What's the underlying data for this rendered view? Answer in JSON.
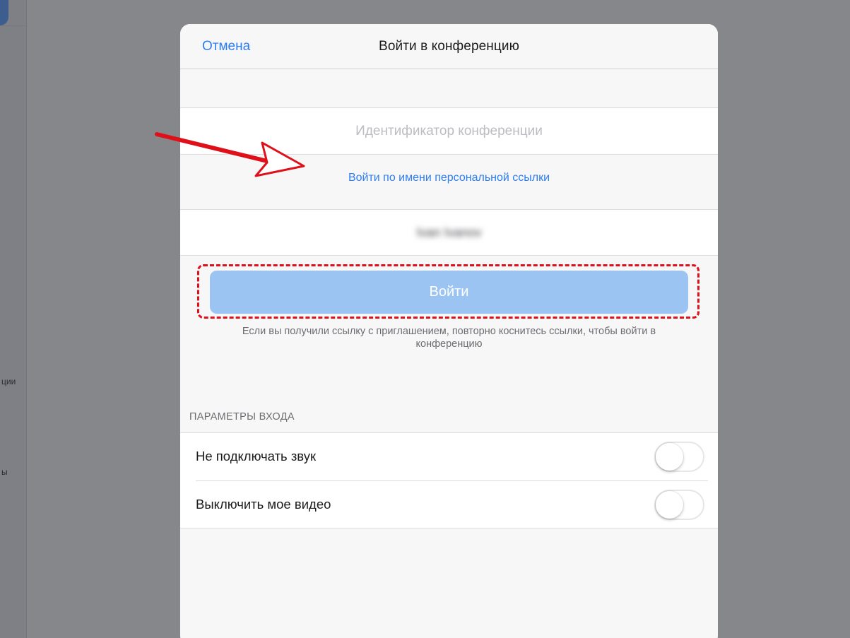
{
  "background": {
    "fragments": [
      "ции",
      "ы"
    ]
  },
  "modal": {
    "nav": {
      "cancel_label": "Отмена",
      "title": "Войти в конференцию"
    },
    "meeting_id": {
      "placeholder": "Идентификатор конференции",
      "value": ""
    },
    "vanity_link_label": "Войти по имени персональной ссылки",
    "name_field": {
      "value": "Ivan Ivanov"
    },
    "join_button_label": "Войти",
    "hint": "Если вы получили ссылку с приглашением, повторно коснитесь ссылки, чтобы войти в конференцию",
    "options": {
      "section_title": "ПАРАМЕТРЫ ВХОДА",
      "items": [
        {
          "label": "Не подключать звук",
          "enabled": false
        },
        {
          "label": "Выключить мое видео",
          "enabled": false
        }
      ]
    }
  },
  "colors": {
    "accent": "#2d7ef2",
    "join_button_disabled": "#9cc4f3",
    "annotation_red": "#e0101b",
    "overlay": "#86878b"
  },
  "icons": {
    "annotation_arrow": "arrow-icon"
  }
}
